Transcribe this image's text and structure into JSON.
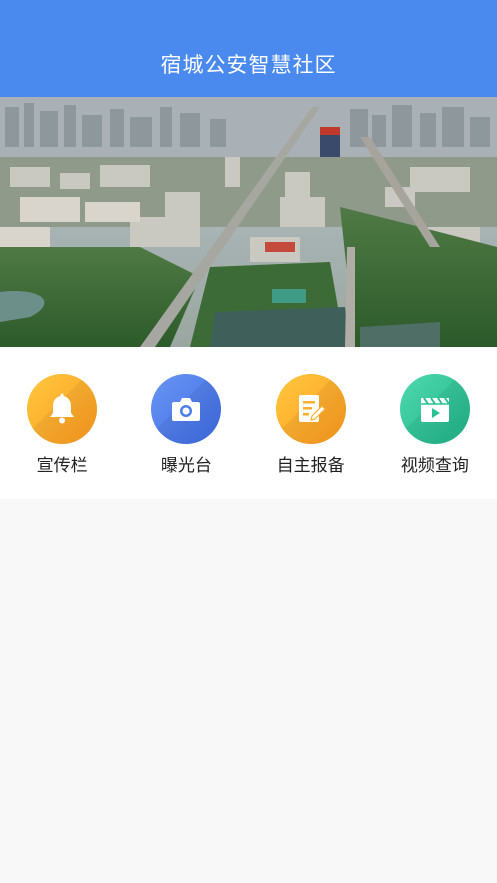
{
  "header": {
    "title": "宿城公安智慧社区"
  },
  "banner": {
    "image": "city-aerial-photo"
  },
  "menu": {
    "items": [
      {
        "label": "宣传栏",
        "icon": "bell-icon",
        "color_from": "#ffc13d",
        "color_to": "#ff9a1f"
      },
      {
        "label": "曝光台",
        "icon": "camera-icon",
        "color_from": "#5b8cf0",
        "color_to": "#3d6be6"
      },
      {
        "label": "自主报备",
        "icon": "edit-document-icon",
        "color_from": "#ffc13d",
        "color_to": "#ff9a1f"
      },
      {
        "label": "视频查询",
        "icon": "video-play-icon",
        "color_from": "#3fd0a4",
        "color_to": "#1fb58a"
      }
    ]
  }
}
